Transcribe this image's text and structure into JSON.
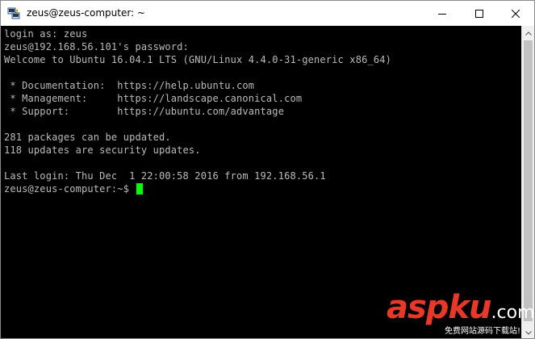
{
  "window": {
    "title": "zeus@zeus-computer: ~",
    "icon": "putty-terminal-icon"
  },
  "controls": {
    "minimize_icon": "minimize-icon",
    "maximize_icon": "maximize-icon",
    "close_icon": "close-icon"
  },
  "terminal": {
    "background": "#000000",
    "foreground": "#bbbbbb",
    "cursor_color": "#00ff00",
    "lines": [
      "login as: zeus",
      "zeus@192.168.56.101's password:",
      "Welcome to Ubuntu 16.04.1 LTS (GNU/Linux 4.4.0-31-generic x86_64)",
      "",
      " * Documentation:  https://help.ubuntu.com",
      " * Management:     https://landscape.canonical.com",
      " * Support:        https://ubuntu.com/advantage",
      "",
      "281 packages can be updated.",
      "118 updates are security updates.",
      "",
      "Last login: Thu Dec  1 22:00:58 2016 from 192.168.56.1"
    ],
    "prompt": "zeus@zeus-computer:~$ "
  },
  "watermark": {
    "logo_main": "aspku",
    "logo_suffix": ".com",
    "subtitle": "免费网站源码下载站!"
  }
}
